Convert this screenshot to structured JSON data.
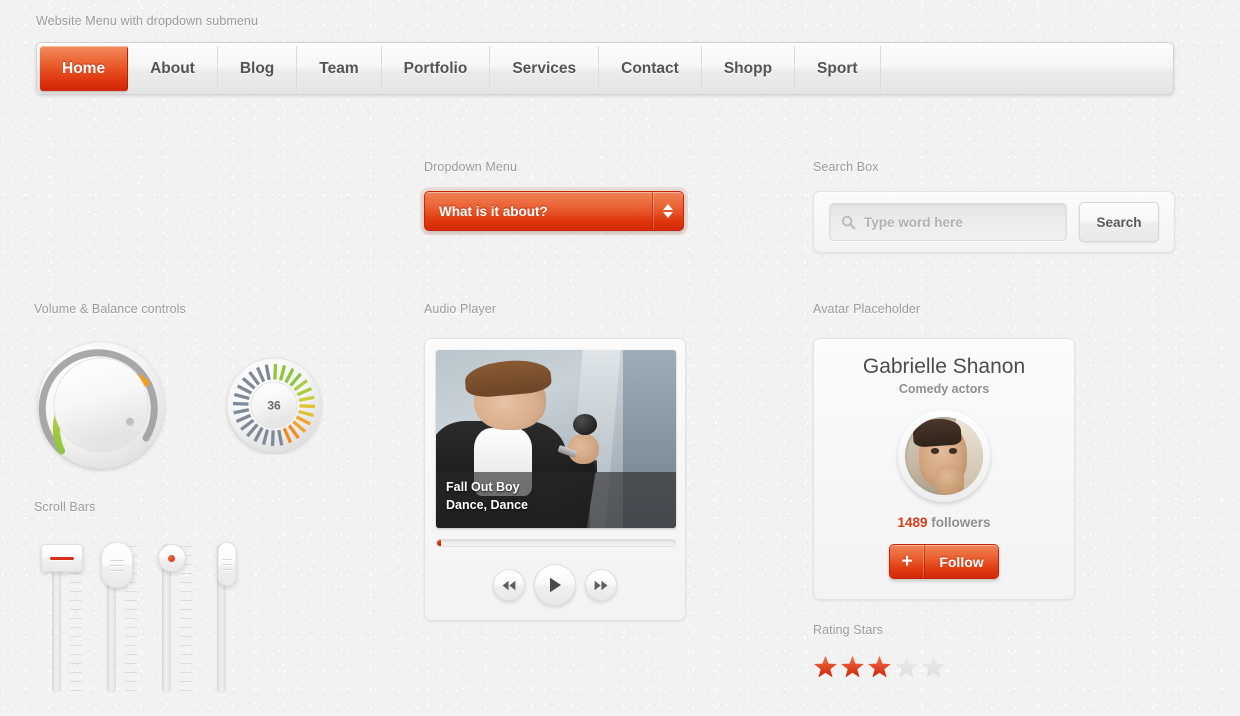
{
  "nav": {
    "title": "Website Menu with dropdown submenu",
    "items": [
      {
        "label": "Home",
        "active": true
      },
      {
        "label": "About",
        "active": false
      },
      {
        "label": "Blog",
        "active": false
      },
      {
        "label": "Team",
        "active": false
      },
      {
        "label": "Portfolio",
        "active": false
      },
      {
        "label": "Services",
        "active": false
      },
      {
        "label": "Contact",
        "active": false
      },
      {
        "label": "Shopp",
        "active": false
      },
      {
        "label": "Sport",
        "active": false
      }
    ]
  },
  "dropdown": {
    "label": "Dropdown Menu",
    "selected": "What is it about?"
  },
  "search": {
    "label": "Search Box",
    "placeholder": "Type word here",
    "value": "",
    "button": "Search"
  },
  "knobs": {
    "label": "Volume & Balance controls",
    "volume_value": 72,
    "balance_value": "36"
  },
  "sliders": {
    "label": "Scroll Bars",
    "handles": [
      "rect-red-line",
      "oval-grip",
      "circle-red-dot",
      "capsule-grip"
    ]
  },
  "player": {
    "label": "Audio Player",
    "artist": "Fall Out Boy",
    "track": "Dance, Dance",
    "progress_percent": 1,
    "controls": [
      "rewind",
      "play",
      "fast-forward"
    ]
  },
  "avatar": {
    "label": "Avatar Placeholder",
    "name": "Gabrielle Shanon",
    "role": "Comedy actors",
    "followers_count": "1489",
    "followers_suffix": " followers",
    "follow_plus": "+",
    "follow_label": "Follow"
  },
  "rating": {
    "label": "Rating Stars",
    "value": 3,
    "max": 5
  },
  "colors": {
    "accent_red": "#d83b16",
    "accent_orange": "#ea6134",
    "label_gray": "#9b9b9b",
    "panel_bg": "#fbfbfb"
  }
}
